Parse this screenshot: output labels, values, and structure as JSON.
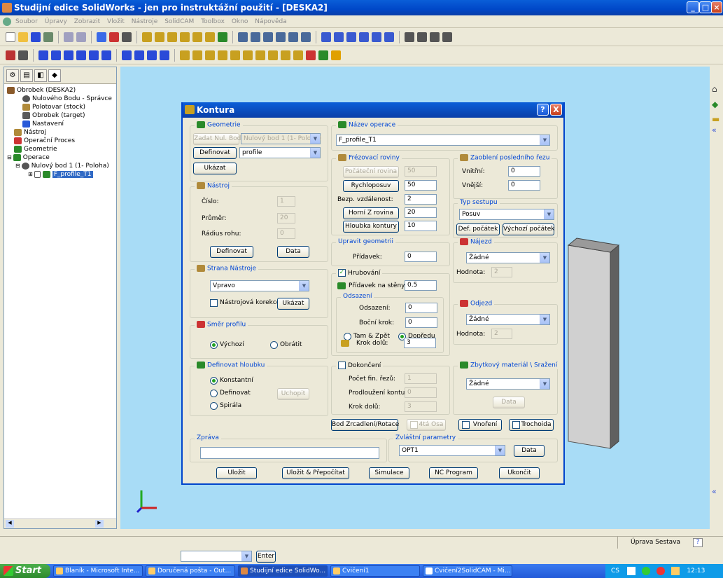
{
  "app": {
    "title": "Studijní edice SolidWorks - jen pro instruktážní použití - [DESKA2]",
    "menus": [
      "Soubor",
      "Úpravy",
      "Zobrazit",
      "Vložit",
      "Nástroje",
      "SolidCAM",
      "Toolbox",
      "Okno",
      "Nápověda"
    ]
  },
  "tree": {
    "items": [
      {
        "label": "Obrobek (DESKA2)",
        "color": "#8a5a2a"
      },
      {
        "label": "Nulového Bodu - Správce",
        "color": "#444"
      },
      {
        "label": "Polotovar (stock)",
        "color": "#b08a3a"
      },
      {
        "label": "Obrobek (target)",
        "color": "#5a5a5a"
      },
      {
        "label": "Nastavení",
        "color": "#2a5ad8"
      },
      {
        "label": "Nástroj",
        "color": "#b08a3a"
      },
      {
        "label": "Operační Proces",
        "color": "#c33"
      },
      {
        "label": "Geometrie",
        "color": "#2a8a2a"
      },
      {
        "label": "Operace",
        "color": "#2a8a2a"
      },
      {
        "label": "Nulový bod 1 (1- Poloha)",
        "color": "#444"
      },
      {
        "label": "F_profile_T1",
        "color": "#2a8a2a"
      }
    ]
  },
  "dialog": {
    "title": "Kontura",
    "help_label": "?",
    "close_label": "X",
    "geometrie": {
      "title": "Geometrie",
      "zadat_label": "Zadat Nul. Bod",
      "zadat_value": "Nulový bod 1 (1- Poloha)",
      "definovat_label": "Definovat",
      "profile_value": "profile",
      "ukazat_label": "Ukázat"
    },
    "nastroj": {
      "title": "Nástroj",
      "cislo_label": "Číslo:",
      "cislo_value": "1",
      "prumer_label": "Průměr:",
      "prumer_value": "20",
      "radius_label": "Rádius rohu:",
      "radius_value": "0",
      "definovat_label": "Definovat",
      "data_label": "Data"
    },
    "strana": {
      "title": "Strana Nástroje",
      "value": "Vpravo",
      "korekce_label": "Nástrojová korekce",
      "ukazat_label": "Ukázat"
    },
    "smer": {
      "title": "Směr profilu",
      "vychozi_label": "Výchozí",
      "obratit_label": "Obrátit"
    },
    "hloubka": {
      "title": "Definovat hloubku",
      "konstantni_label": "Konstantní",
      "definovat_label": "Definovat",
      "uchopit_label": "Uchopit",
      "spirala_label": "Spirála"
    },
    "nazev": {
      "title": "Název operace",
      "value": "F_profile_T1"
    },
    "frezovaci": {
      "title": "Frézovací roviny",
      "pocatecni_label": "Počáteční rovina",
      "pocatecni_value": "50",
      "rychloposuv_label": "Rychloposuv",
      "rychloposuv_value": "50",
      "bezp_label": "Bezp. vzdálenost:",
      "bezp_value": "2",
      "horni_label": "Horní Z rovina",
      "horni_value": "20",
      "hloubka_label": "Hloubka kontury",
      "hloubka_value": "10"
    },
    "zaobleni": {
      "title": "Zaoblení posledního řezu",
      "vnitrni_label": "Vnitřní:",
      "vnitrni_value": "0",
      "vnejsi_label": "Vnější:",
      "vnejsi_value": "0"
    },
    "sestup": {
      "title": "Typ sestupu",
      "value": "Posuv",
      "def_label": "Def. počátek",
      "vychozi_label": "Výchozí počátek"
    },
    "upravit": {
      "title": "Upravit geometrii",
      "pridavek_label": "Přídavek:",
      "pridavek_value": "0"
    },
    "najezd": {
      "title": "Nájezd",
      "value": "Žádné",
      "hodnota_label": "Hodnota:",
      "hodnota_value": "2"
    },
    "odjezd": {
      "title": "Odjezd",
      "value": "Žádné",
      "hodnota_label": "Hodnota:",
      "hodnota_value": "2"
    },
    "hrubovani": {
      "title": "Hrubování",
      "steny_label": "Přídavek na stěny:",
      "steny_value": "0.5",
      "odsazeni_title": "Odsazení",
      "odsazeni_label": "Odsazení:",
      "odsazeni_value": "0",
      "bocni_label": "Boční krok:",
      "bocni_value": "0",
      "tam_label": "Tam & Zpět",
      "dopredu_label": "Dopředu",
      "krok_label": "Krok dolů:",
      "krok_value": "3"
    },
    "dokonceni": {
      "title": "Dokončení",
      "pocet_label": "Počet fin. řezů:",
      "pocet_value": "1",
      "prodlouzeni_label": "Prodloužení kontury:",
      "prodlouzeni_value": "0",
      "krok_label": "Krok dolů:",
      "krok_value": "3"
    },
    "zbytkovy": {
      "title": "Zbytkový materiál \\ Sražení",
      "value": "Žádné",
      "data_label": "Data"
    },
    "bod_label": "Bod Zrcadlení/Rotace",
    "osa_label": "4tá Osa",
    "vnoreni_label": "Vnoření",
    "trochoida_label": "Trochoida",
    "zprava": {
      "title": "Zpráva"
    },
    "zvlastni": {
      "title": "Zvláštní parametry",
      "value": "OPT1",
      "data_label": "Data"
    },
    "footer": {
      "ulozit": "Uložit",
      "prepocitat": "Uložit & Přepočítat",
      "simulace": "Simulace",
      "nc": "NC Program",
      "ukoncit": "Ukončit"
    }
  },
  "status": {
    "text": "Úprava Sestava",
    "help": "?"
  },
  "cmd": {
    "enter_label": "Enter"
  },
  "taskbar": {
    "start": "Start",
    "tasks": [
      "Blaník - Microsoft Inte...",
      "Doručená pošta - Out...",
      "Studijní edice SolidWo...",
      "Cvičení1",
      "Cvičení2SolidCAM - Mi..."
    ],
    "lang": "CS",
    "time": "12:13"
  }
}
